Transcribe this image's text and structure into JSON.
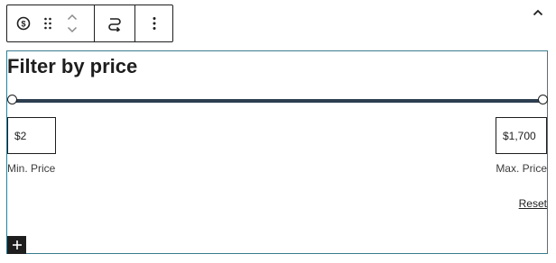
{
  "toolbar": {
    "block_icon": "dollar-circle-icon",
    "drag_icon": "drag-handle-icon",
    "move_icons": [
      "chevron-up-icon",
      "chevron-down-icon"
    ],
    "transform_icon": "loop-icon",
    "options_icon": "more-vertical-icon"
  },
  "collapse_icon": "chevron-up-icon",
  "block": {
    "title": "Filter by price",
    "slider": {
      "min_fraction": 0,
      "max_fraction": 1
    },
    "min_input": {
      "value": "$2",
      "label": "Min. Price"
    },
    "max_input": {
      "value": "$1,700",
      "label": "Max. Price"
    },
    "reset_label": "Reset",
    "add_icon": "plus-icon"
  },
  "colors": {
    "text": "#1e1e1e",
    "block_border": "#3a7b8f",
    "slider_track": "#2c3e50"
  }
}
